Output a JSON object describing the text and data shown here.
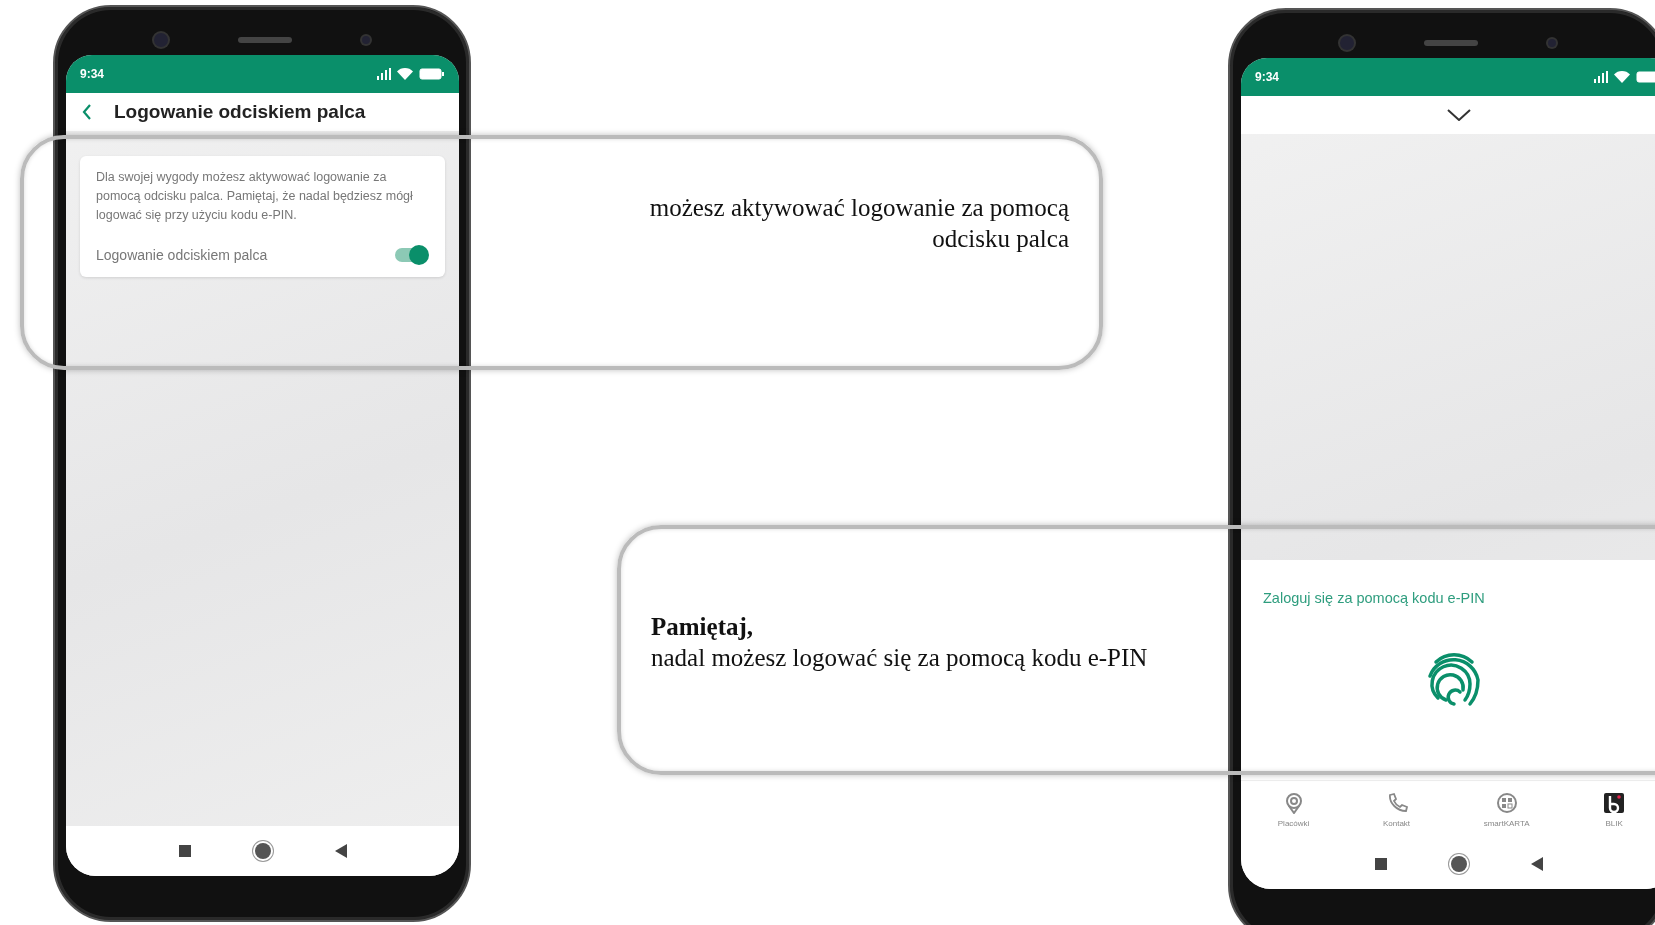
{
  "left_phone": {
    "status_bar": {
      "time": "9:34"
    },
    "header": {
      "title": "Logowanie odciskiem palca"
    },
    "card": {
      "description": "Dla swojej wygody możesz aktywować logowanie za pomocą odcisku palca. Pamiętaj, że nadal będziesz mógł logować się przy użyciu kodu e-PIN.",
      "setting": {
        "label": "Logowanie odciskiem palca",
        "on": true
      }
    }
  },
  "right_phone": {
    "status_bar": {
      "time": "9:34"
    },
    "login_sheet": {
      "link": "Zaloguj się za pomocą kodu e-PIN"
    },
    "bottom_nav": [
      {
        "kind": "location",
        "label": "Placówki"
      },
      {
        "kind": "phone",
        "label": "Kontakt"
      },
      {
        "kind": "smartcard",
        "label": "smartKARTA"
      },
      {
        "kind": "blik",
        "label": "BLIK"
      }
    ]
  },
  "callouts": {
    "fingerprint_note": {
      "text": "możesz aktywować logowanie za pomocą odcisku palca"
    },
    "reminder": {
      "heading": "Pamiętaj,",
      "text": "nadal możesz logować się za pomocą kodu e-PIN"
    }
  }
}
